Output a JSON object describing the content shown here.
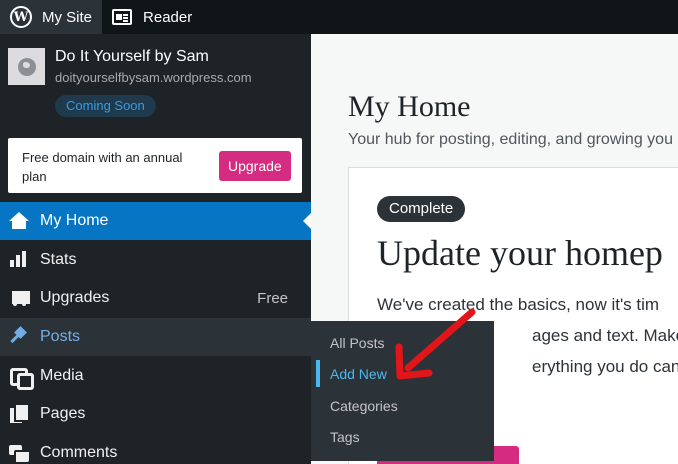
{
  "masterbar": {
    "my_site_label": "My Site",
    "reader_label": "Reader"
  },
  "site": {
    "title": "Do It Yourself by Sam",
    "url": "doityourselfbysam.wordpress.com",
    "status_badge": "Coming Soon"
  },
  "upsell": {
    "text": "Free domain with an annual plan",
    "button_label": "Upgrade"
  },
  "sidebar": {
    "items": [
      {
        "label": "My Home",
        "icon": "home-icon"
      },
      {
        "label": "Stats",
        "icon": "stats-icon"
      },
      {
        "label": "Upgrades",
        "icon": "cart-icon",
        "meta": "Free"
      },
      {
        "label": "Posts",
        "icon": "pin-icon"
      },
      {
        "label": "Media",
        "icon": "media-icon"
      },
      {
        "label": "Pages",
        "icon": "pages-icon"
      },
      {
        "label": "Comments",
        "icon": "comments-icon"
      }
    ]
  },
  "posts_flyout": {
    "items": [
      "All Posts",
      "Add New",
      "Categories",
      "Tags"
    ]
  },
  "main": {
    "title": "My Home",
    "subtitle": "Your hub for posting, editing, and growing you",
    "card": {
      "badge": "Complete",
      "title": "Update your homep",
      "lines": [
        "We've created the basics, now it's tim",
        "ages and text. Make a g",
        "erything you do can be"
      ]
    }
  },
  "colors": {
    "masterbar_bg": "#101517",
    "sidebar_bg": "#1d2327",
    "current_item": "#0675c4",
    "accent_pink": "#d52c82",
    "link_blue": "#4ab8f0",
    "annotation_red": "#e0161b"
  }
}
